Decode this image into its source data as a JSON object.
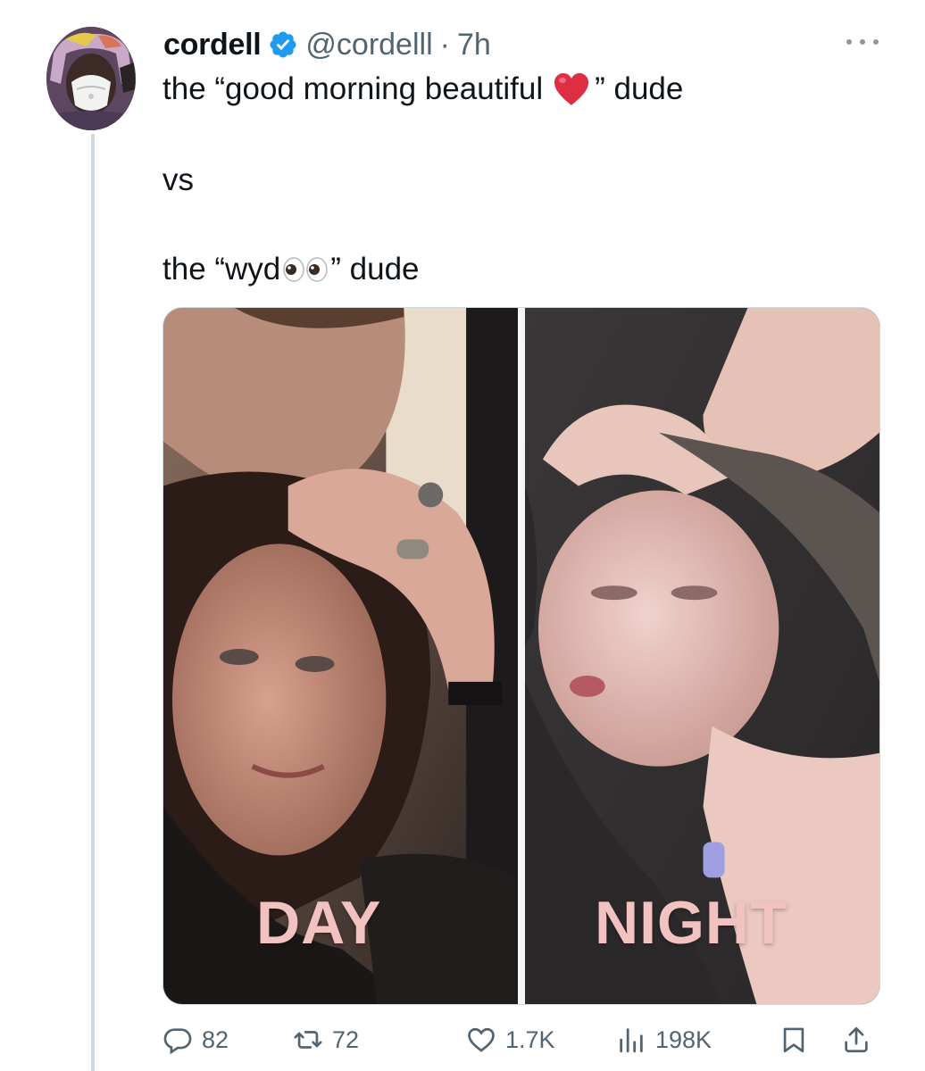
{
  "tweet": {
    "author": {
      "display_name": "cordell",
      "verified": true,
      "handle": "@cordelll",
      "separator": "·",
      "time": "7h"
    },
    "text": {
      "line1_before": "the “good morning beautiful",
      "line1_emoji": "red-heart",
      "line1_after": "” dude",
      "line2": "vs",
      "line3_before": "the “wyd",
      "line3_emoji": "eyes",
      "line3_after": "” dude"
    },
    "media": {
      "left_label": "DAY",
      "right_label": "NIGHT"
    },
    "actions": {
      "replies": "82",
      "retweets": "72",
      "likes": "1.7K",
      "views": "198K"
    }
  },
  "colors": {
    "text_primary": "#0f1419",
    "text_secondary": "#536471",
    "verified_blue": "#1d9bf0",
    "thread_line": "#cfd9de",
    "label_pink": "#f1c2c0"
  },
  "icons": [
    "verified-badge-icon",
    "more-options-icon",
    "reply-icon",
    "retweet-icon",
    "like-icon",
    "views-icon",
    "bookmark-icon",
    "share-icon"
  ]
}
